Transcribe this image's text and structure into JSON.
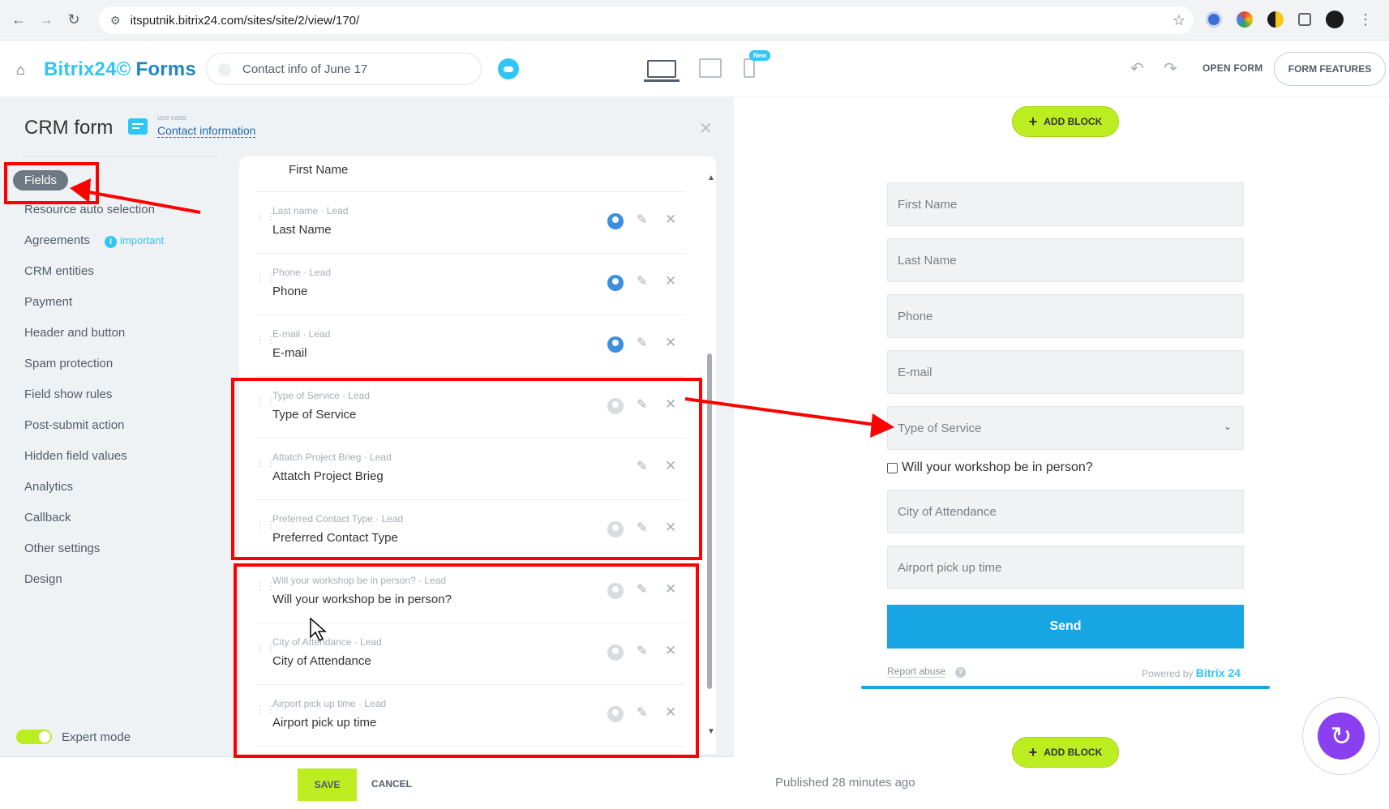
{
  "browser": {
    "url": "itsputnik.bitrix24.com/sites/site/2/view/170/"
  },
  "header": {
    "brand": "Bitrix24©",
    "product": "Forms",
    "page_title": "Contact info of June 17",
    "new_badge": "New",
    "open_form": "OPEN FORM",
    "form_features": "FORM FEATURES"
  },
  "panel": {
    "title": "CRM form",
    "usecase_label": "use case",
    "usecase_link": "Contact information"
  },
  "menu": {
    "items": [
      "Fields",
      "Resource auto selection",
      "Agreements",
      "CRM entities",
      "Payment",
      "Header and button",
      "Spam protection",
      "Field show rules",
      "Post-submit action",
      "Hidden field values",
      "Analytics",
      "Callback",
      "Other settings",
      "Design"
    ],
    "important": "important",
    "expert_mode": "Expert mode"
  },
  "fields": {
    "partial_top": "First Name",
    "rows": [
      {
        "sub": "Last name · Lead",
        "name": "Last Name"
      },
      {
        "sub": "Phone · Lead",
        "name": "Phone"
      },
      {
        "sub": "E-mail · Lead",
        "name": "E-mail"
      },
      {
        "sub": "Type of Service · Lead",
        "name": "Type of Service"
      },
      {
        "sub": "Attatch Project Brieg · Lead",
        "name": "Attatch Project Brieg"
      },
      {
        "sub": "Preferred Contact Type · Lead",
        "name": "Preferred Contact Type"
      },
      {
        "sub": "Will your workshop be in person? · Lead",
        "name": "Will your workshop be in person?"
      },
      {
        "sub": "City of Attendance · Lead",
        "name": "City of Attendance"
      },
      {
        "sub": "Airport pick up time · Lead",
        "name": "Airport pick up time"
      }
    ]
  },
  "footer": {
    "save": "SAVE",
    "cancel": "CANCEL"
  },
  "preview": {
    "add_block": "ADD BLOCK",
    "inputs": [
      "First Name",
      "Last Name",
      "Phone",
      "E-mail"
    ],
    "select": "Type of Service",
    "checkbox": "Will your workshop be in person?",
    "inputs2": [
      "City of Attendance",
      "Airport pick up time"
    ],
    "send": "Send",
    "report_abuse": "Report abuse",
    "powered_by": "Powered by",
    "powered_brand": "Bitrix 24",
    "published": "Published 28 minutes ago"
  },
  "colors": {
    "accent": "#2fc6f6",
    "send": "#17a6e3",
    "green": "#bbed21",
    "annotation": "#ff0000"
  }
}
